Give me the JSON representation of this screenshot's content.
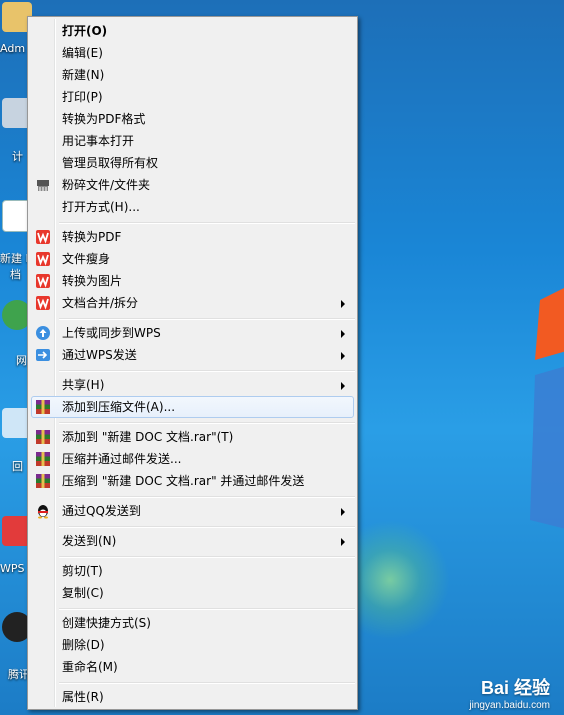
{
  "desktop": {
    "icons": [
      {
        "label": "Adm"
      },
      {
        "label": "计"
      },
      {
        "label": "新建 I"
      },
      {
        "label": "档"
      },
      {
        "label": "网"
      },
      {
        "label": "回"
      },
      {
        "label": "WPS"
      },
      {
        "label": "腾讯"
      }
    ]
  },
  "context_menu": {
    "items": [
      {
        "label": "打开(O)"
      },
      {
        "label": "编辑(E)"
      },
      {
        "label": "新建(N)"
      },
      {
        "label": "打印(P)"
      },
      {
        "label": "转换为PDF格式"
      },
      {
        "label": "用记事本打开"
      },
      {
        "label": "管理员取得所有权"
      },
      {
        "label": "粉碎文件/文件夹",
        "icon": "shredder-icon"
      },
      {
        "label": "打开方式(H)..."
      },
      {
        "label": "转换为PDF",
        "icon": "wps-icon"
      },
      {
        "label": "文件瘦身",
        "icon": "wps-icon"
      },
      {
        "label": "转换为图片",
        "icon": "wps-icon"
      },
      {
        "label": "文档合并/拆分",
        "icon": "wps-icon"
      },
      {
        "label": "上传或同步到WPS",
        "icon": "cloud-upload-icon"
      },
      {
        "label": "通过WPS发送",
        "icon": "send-arrow-icon"
      },
      {
        "label": "共享(H)"
      },
      {
        "label": "添加到压缩文件(A)...",
        "icon": "winrar-icon"
      },
      {
        "label": "添加到 \"新建 DOC 文档.rar\"(T)",
        "icon": "winrar-icon"
      },
      {
        "label": "压缩并通过邮件发送...",
        "icon": "winrar-icon"
      },
      {
        "label": "压缩到 \"新建 DOC 文档.rar\" 并通过邮件发送",
        "icon": "winrar-icon"
      },
      {
        "label": "通过QQ发送到",
        "icon": "qq-icon"
      },
      {
        "label": "发送到(N)"
      },
      {
        "label": "剪切(T)"
      },
      {
        "label": "复制(C)"
      },
      {
        "label": "创建快捷方式(S)"
      },
      {
        "label": "删除(D)"
      },
      {
        "label": "重命名(M)"
      },
      {
        "label": "属性(R)"
      }
    ]
  },
  "watermark": {
    "logo": "Bai 经验",
    "url": "jingyan.baidu.com"
  }
}
